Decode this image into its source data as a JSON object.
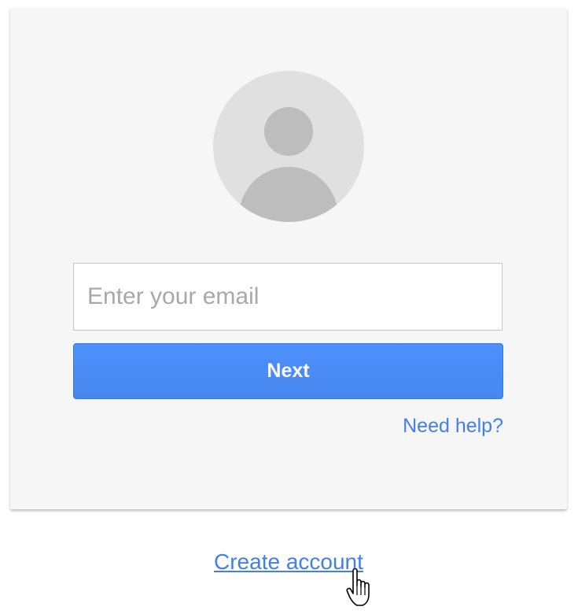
{
  "login": {
    "email_placeholder": "Enter your email",
    "next_label": "Next",
    "need_help_label": "Need help?"
  },
  "footer": {
    "create_account_label": "Create account"
  },
  "colors": {
    "card_background": "#f6f6f6",
    "button_blue": "#4787ed",
    "link_blue": "#427fed",
    "avatar_light": "#e0e0e0",
    "avatar_dark": "#bdbdbd"
  },
  "icons": {
    "avatar": "default-profile-avatar-icon",
    "cursor": "hand-pointer-cursor-icon"
  }
}
